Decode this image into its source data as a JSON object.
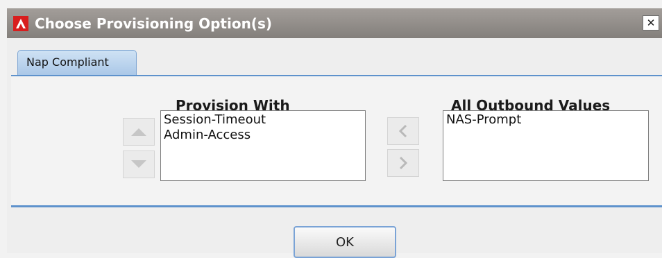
{
  "window": {
    "title": "Choose Provisioning Option(s)",
    "close_glyph": "✕"
  },
  "tabs": [
    {
      "label": "Nap Compliant"
    }
  ],
  "provision_with": {
    "title": "Provision With",
    "items": [
      "Session-Timeout",
      "Admin-Access"
    ]
  },
  "all_outbound": {
    "title": "All Outbound Values",
    "items": [
      "NAS-Prompt"
    ]
  },
  "buttons": {
    "ok_label": "OK"
  },
  "colors": {
    "accent": "#5e92cc",
    "titlebar": "#938f8b",
    "logo": "#d81e1e"
  },
  "icons": [
    "app-logo-icon",
    "close-icon",
    "arrow-up-icon",
    "arrow-down-icon",
    "arrow-left-icon",
    "arrow-right-icon"
  ]
}
